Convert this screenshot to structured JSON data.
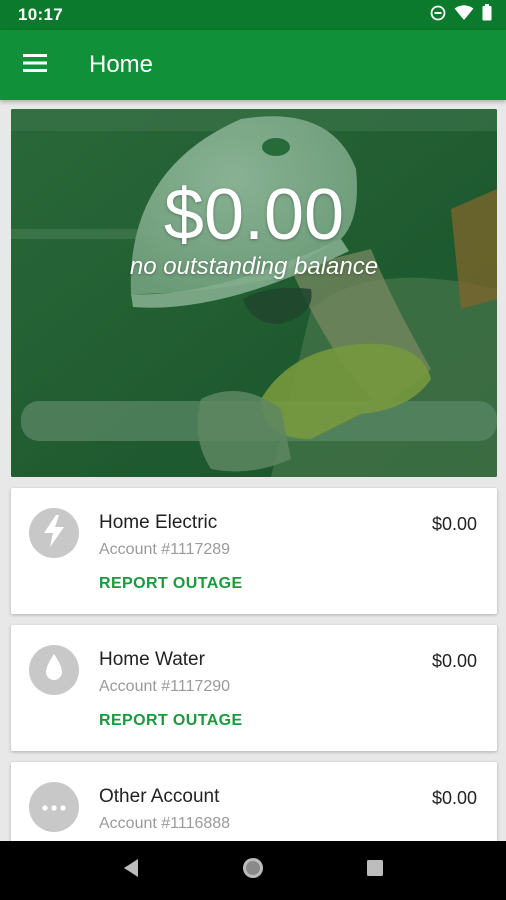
{
  "status_bar": {
    "time": "10:17",
    "icons": [
      "do-not-disturb-icon",
      "wifi-icon",
      "battery-icon"
    ]
  },
  "app_bar": {
    "title": "Home",
    "menu_icon": "hamburger-menu-icon"
  },
  "hero": {
    "amount": "$0.00",
    "subtitle": "no outstanding balance"
  },
  "accounts": [
    {
      "name": "Home Electric",
      "account": "Account #1117289",
      "balance": "$0.00",
      "action": "REPORT OUTAGE",
      "icon": "lightning-bolt-icon"
    },
    {
      "name": "Home Water",
      "account": "Account #1117290",
      "balance": "$0.00",
      "action": "REPORT OUTAGE",
      "icon": "water-drop-icon"
    },
    {
      "name": "Other Account",
      "account": "Account #1116888",
      "balance": "$0.00",
      "icon": "more-dots-icon"
    }
  ],
  "nav_bar": {
    "buttons": [
      "back-icon",
      "home-icon",
      "recents-icon"
    ]
  },
  "colors": {
    "status_bar": "#0c7a2c",
    "app_bar": "#11903a",
    "accent": "#1a9a3e",
    "icon_circle": "#c8c8c8"
  }
}
